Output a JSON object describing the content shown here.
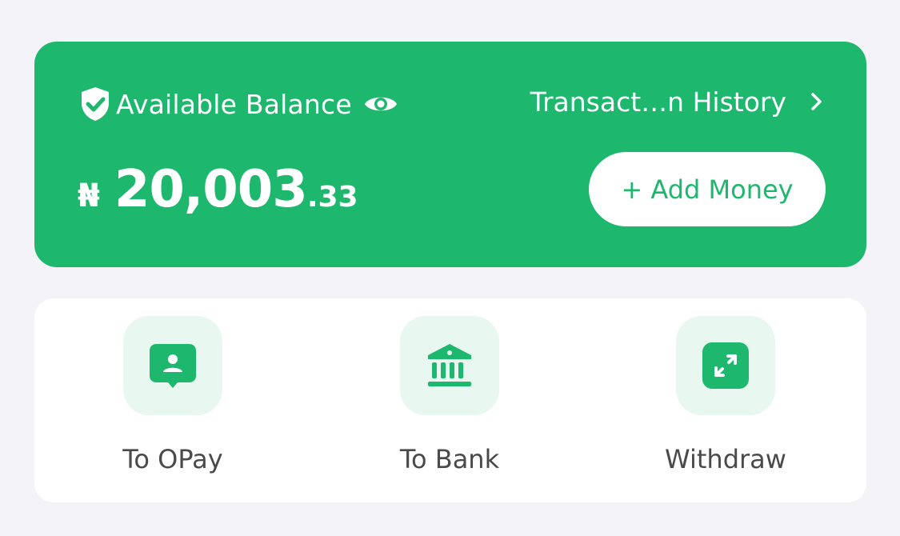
{
  "balance": {
    "label": "Available Balance",
    "currency_symbol": "₦",
    "amount_main": "20,003",
    "amount_cents": ".33",
    "history_link": "Transact…n History",
    "add_money_label": "+ Add Money"
  },
  "quick_actions": [
    {
      "label": "To OPay",
      "icon": "opay-user-icon"
    },
    {
      "label": "To Bank",
      "icon": "bank-icon"
    },
    {
      "label": "Withdraw",
      "icon": "withdraw-arrows-icon"
    }
  ],
  "colors": {
    "brand_green": "#1db86d",
    "icon_tile_bg": "#e8f7ef",
    "page_bg": "#f3f3f8"
  }
}
